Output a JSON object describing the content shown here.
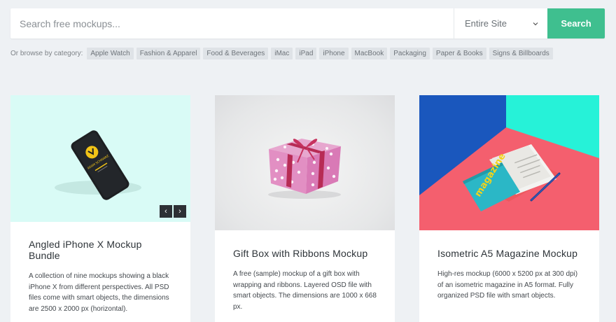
{
  "search": {
    "placeholder": "Search free mockups...",
    "scope": "Entire Site",
    "button": "Search"
  },
  "categories": {
    "label": "Or browse by category:",
    "items": [
      "Apple Watch",
      "Fashion & Apparel",
      "Food & Beverages",
      "iMac",
      "iPad",
      "iPhone",
      "MacBook",
      "Packaging",
      "Paper & Books",
      "Signs & Billboards"
    ]
  },
  "cards": [
    {
      "title": "Angled iPhone X Mockup Bundle",
      "description": "A collection of nine mockups showing a black iPhone X from different perspectives. All PSD files come with smart objects, the dimensions are 2500 x 2000 px (horizontal).",
      "nav_prev": "‹",
      "nav_next": "›"
    },
    {
      "title": "Gift Box with Ribbons Mockup",
      "description": "A free (sample) mockup of a gift box with wrapping and ribbons. Layered OSD file with smart objects. The dimensions are 1000 x 668 px."
    },
    {
      "title": "Isometric A5 Magazine Mockup",
      "description": "High-res mockup (6000 x 5200 px at 300 dpi) of an isometric magazine in A5 format. Fully organized PSD file with smart objects."
    }
  ],
  "colors": {
    "accent": "#3fbf8f",
    "page_background": "#eef1f4"
  },
  "image_text": {
    "magazine_cover": "magazine",
    "phone_screen": "ADAM SCHWARZ"
  }
}
